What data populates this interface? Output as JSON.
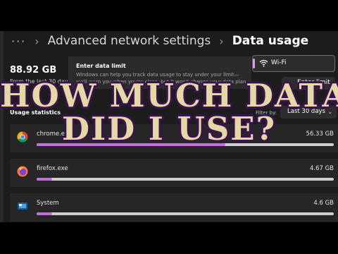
{
  "breadcrumb": {
    "more": "···",
    "parent": "Advanced network settings",
    "current": "Data usage"
  },
  "summary": {
    "total": "88.92 GB",
    "period": "From the last 30 days"
  },
  "popup": {
    "title": "Enter data limit",
    "desc_line1": "Windows can help you track data usage to stay under your limit—",
    "desc_line2": "we'll warn you when you're close, but it won't change your data plan"
  },
  "network": {
    "selected": "Wi-Fi",
    "icon": "wifi-icon",
    "accent": "#d69be8"
  },
  "enter_limit_button": "Enter limit",
  "usage": {
    "heading": "Usage statistics",
    "filter_label": "Filter by:",
    "filter_value": "Last 30 days",
    "apps": [
      {
        "name": "chrome.exe",
        "size": "56.33 GB",
        "share": 0.634,
        "icon": "chrome-icon"
      },
      {
        "name": "firefox.exe",
        "size": "4.67 GB",
        "share": 0.052,
        "icon": "firefox-icon"
      },
      {
        "name": "System",
        "size": "4.6 GB",
        "share": 0.052,
        "icon": "system-icon"
      }
    ],
    "bar_color": "#c46fd8"
  },
  "overlay": {
    "line1": "HOW MUCH DATA",
    "line2": "DID I USE?"
  }
}
